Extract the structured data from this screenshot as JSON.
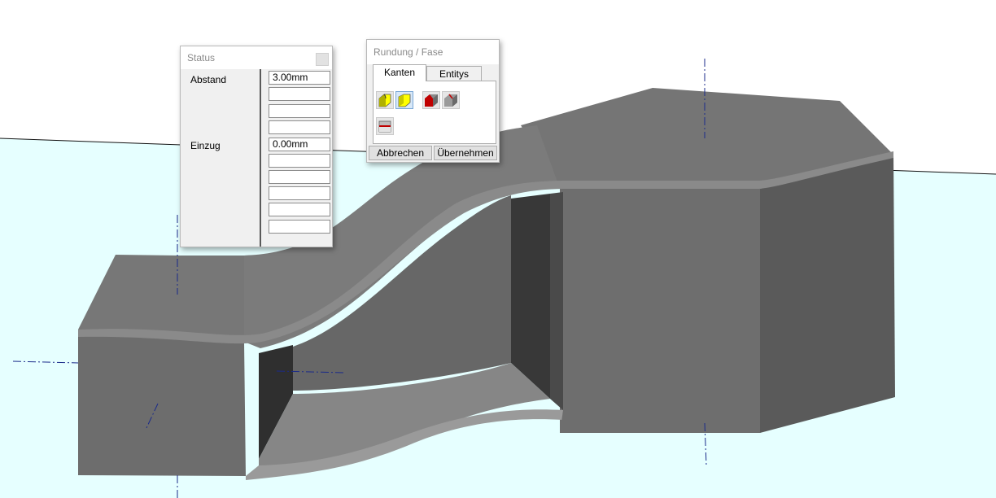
{
  "status_panel": {
    "title": "Status",
    "abstand_label": "Abstand",
    "abstand_value": "3.00mm",
    "einzug_label": "Einzug",
    "einzug_value": "0.00mm"
  },
  "rundung_panel": {
    "title": "Rundung / Fase",
    "tabs": [
      {
        "label": "Kanten",
        "active": true
      },
      {
        "label": "Entitys",
        "active": false
      }
    ],
    "icons": [
      "fillet-edge-yellow-icon",
      "fillet-edge-yellow-selected-icon",
      "chamfer-red-edge-icon",
      "chamfer-grey-edge-icon",
      "fillet-red-face-icon"
    ],
    "cancel_label": "Abbrechen",
    "apply_label": "Übernehmen"
  },
  "colors": {
    "background_top": "#ffffff",
    "background_ground": "#e6ffff",
    "part_light": "#7a7a7a",
    "part_mid": "#6b6b6b",
    "part_dark": "#3b3b3b",
    "axis_line": "#1a2a8a",
    "highlight_yellow": "#ffff00",
    "highlight_red": "#c00000"
  }
}
